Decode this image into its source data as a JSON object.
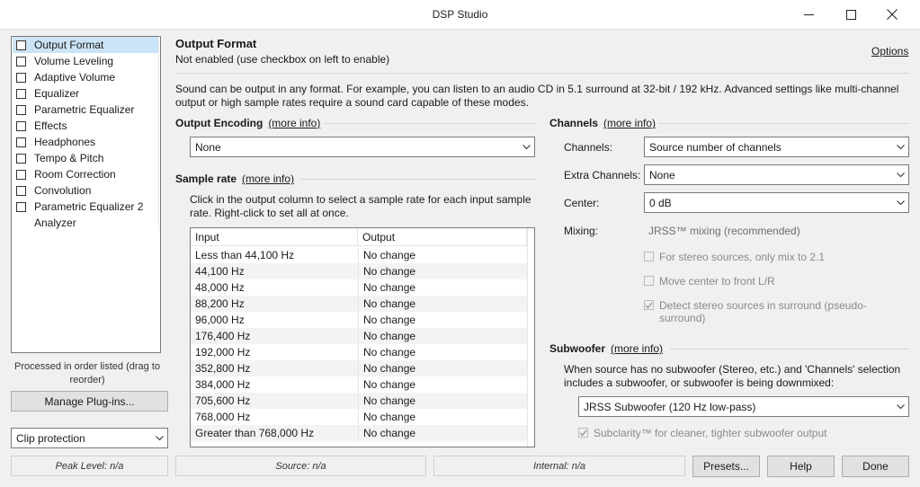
{
  "window": {
    "title": "DSP Studio",
    "minimize_icon": "minimize-icon",
    "maximize_icon": "maximize-icon",
    "close_icon": "close-icon"
  },
  "plugins": [
    {
      "label": "Output Format",
      "checkbox": true,
      "checked": false,
      "selected": true
    },
    {
      "label": "Volume Leveling",
      "checkbox": true,
      "checked": false,
      "selected": false
    },
    {
      "label": "Adaptive Volume",
      "checkbox": true,
      "checked": false,
      "selected": false
    },
    {
      "label": "Equalizer",
      "checkbox": true,
      "checked": false,
      "selected": false
    },
    {
      "label": "Parametric Equalizer",
      "checkbox": true,
      "checked": false,
      "selected": false
    },
    {
      "label": "Effects",
      "checkbox": true,
      "checked": false,
      "selected": false
    },
    {
      "label": "Headphones",
      "checkbox": true,
      "checked": false,
      "selected": false
    },
    {
      "label": "Tempo & Pitch",
      "checkbox": true,
      "checked": false,
      "selected": false
    },
    {
      "label": "Room Correction",
      "checkbox": true,
      "checked": false,
      "selected": false
    },
    {
      "label": "Convolution",
      "checkbox": true,
      "checked": false,
      "selected": false
    },
    {
      "label": "Parametric Equalizer 2",
      "checkbox": true,
      "checked": false,
      "selected": false
    },
    {
      "label": "Analyzer",
      "checkbox": false,
      "checked": false,
      "selected": false
    }
  ],
  "left": {
    "order_note": "Processed in order listed (drag to reorder)",
    "manage_label": "Manage Plug-ins...",
    "clip_value": "Clip protection"
  },
  "status": {
    "peak": "Peak Level: n/a",
    "source": "Source: n/a",
    "internal": "Internal: n/a"
  },
  "buttons": {
    "presets": "Presets...",
    "help": "Help",
    "done": "Done"
  },
  "panel": {
    "title": "Output Format",
    "subtitle": "Not enabled (use checkbox on left to enable)",
    "options_link": "Options",
    "description": "Sound can be output in any format.  For example, you can listen to an audio CD in 5.1 surround at 32-bit / 192 kHz.  Advanced settings like multi-channel output or high sample rates require a sound card capable of these modes."
  },
  "encoding": {
    "heading": "Output Encoding",
    "more_info": "(more info)",
    "value": "None"
  },
  "sample_rate": {
    "heading": "Sample rate",
    "more_info": "(more info)",
    "description": "Click in the output column to select a sample rate for each input sample rate.  Right-click to set all at once.",
    "columns": [
      "Input",
      "Output"
    ],
    "rows": [
      {
        "input": "Less than 44,100 Hz",
        "output": "No change"
      },
      {
        "input": "44,100 Hz",
        "output": "No change"
      },
      {
        "input": "48,000 Hz",
        "output": "No change"
      },
      {
        "input": "88,200 Hz",
        "output": "No change"
      },
      {
        "input": "96,000 Hz",
        "output": "No change"
      },
      {
        "input": "176,400 Hz",
        "output": "No change"
      },
      {
        "input": "192,000 Hz",
        "output": "No change"
      },
      {
        "input": "352,800 Hz",
        "output": "No change"
      },
      {
        "input": "384,000 Hz",
        "output": "No change"
      },
      {
        "input": "705,600 Hz",
        "output": "No change"
      },
      {
        "input": "768,000 Hz",
        "output": "No change"
      },
      {
        "input": "Greater than 768,000 Hz",
        "output": "No change"
      }
    ]
  },
  "channels": {
    "heading": "Channels",
    "more_info": "(more info)",
    "channels_label": "Channels:",
    "channels_value": "Source number of channels",
    "extra_label": "Extra Channels:",
    "extra_value": "None",
    "center_label": "Center:",
    "center_value": "0 dB",
    "mixing_label": "Mixing:",
    "mixing_value": "JRSS™ mixing (recommended)",
    "options": [
      {
        "label": "For stereo sources, only mix to 2.1",
        "checked": false
      },
      {
        "label": "Move center to front L/R",
        "checked": false
      },
      {
        "label": "Detect stereo sources in surround (pseudo-surround)",
        "checked": true
      }
    ]
  },
  "subwoofer": {
    "heading": "Subwoofer",
    "more_info": "(more info)",
    "description": "When source has no subwoofer (Stereo, etc.) and 'Channels' selection includes a subwoofer, or subwoofer is being downmixed:",
    "value": "JRSS Subwoofer (120 Hz low-pass)",
    "subclarity_label": "Subclarity™ for cleaner, tighter subwoofer output",
    "subclarity_checked": true
  }
}
